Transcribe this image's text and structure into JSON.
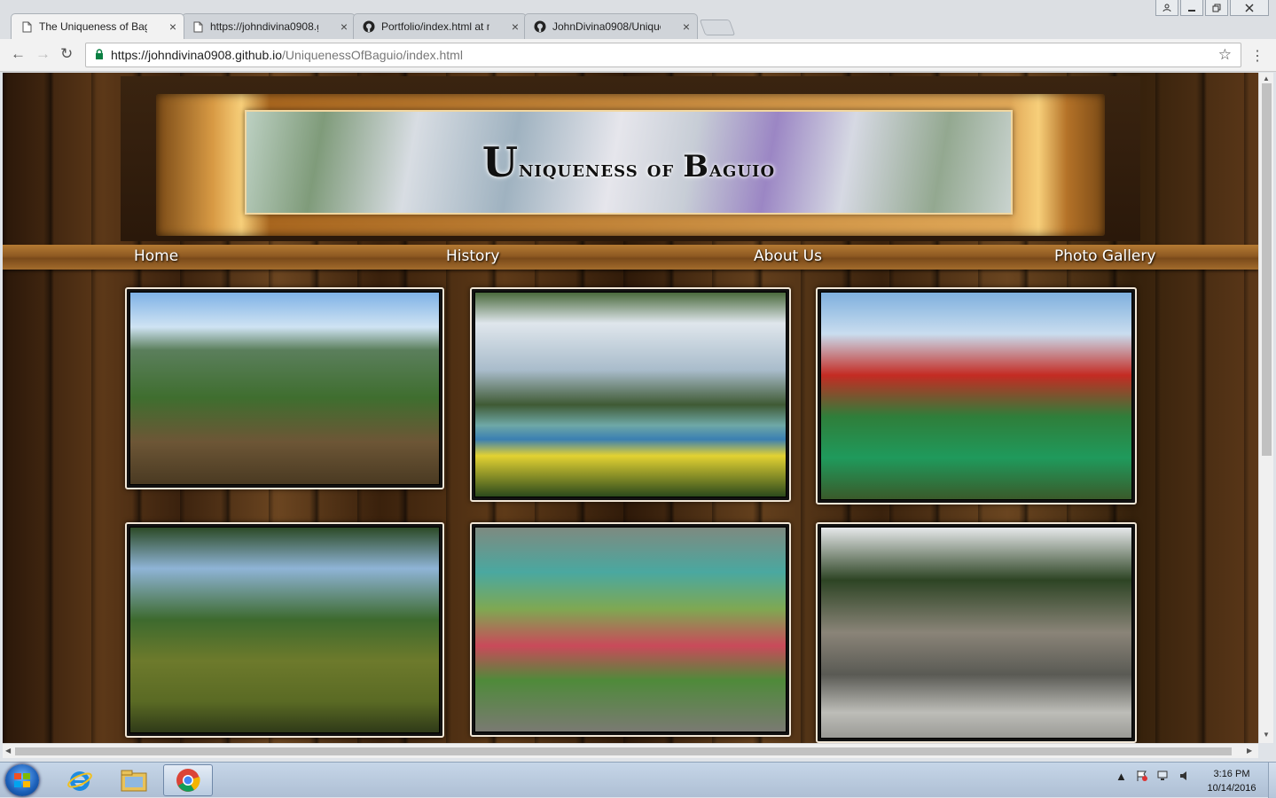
{
  "browser": {
    "tabs": [
      {
        "title": "The Uniqueness of Bagui",
        "icon": "page-icon",
        "active": true
      },
      {
        "title": "https://johndivina0908.g",
        "icon": "page-icon",
        "active": false
      },
      {
        "title": "Portfolio/index.html at m",
        "icon": "github-icon",
        "active": false
      },
      {
        "title": "JohnDivina0908/Uniquen",
        "icon": "github-icon",
        "active": false
      }
    ],
    "url_scheme_host": "https://johndivina0908.github.io",
    "url_path": "/UniquenessOfBaguio/index.html",
    "back_glyph": "←",
    "forward_glyph": "→",
    "reload_glyph": "↻",
    "star_glyph": "☆",
    "menu_glyph": "⋮",
    "close_glyph": "×"
  },
  "site": {
    "banner_title_first_cap": "U",
    "banner_title_rest": "niqueness of ",
    "banner_title_second_cap": "B",
    "banner_title_end": "aguio",
    "nav": [
      "Home",
      "History",
      "About Us",
      "Photo Gallery"
    ],
    "photos": [
      {
        "name": "mountain-view-photo"
      },
      {
        "name": "burnham-lake-boats-photo"
      },
      {
        "name": "bell-church-temple-photo"
      },
      {
        "name": "pine-park-pond-photo"
      },
      {
        "name": "botanical-garden-gazebo-photo"
      },
      {
        "name": "philippine-military-academy-gate-photo"
      }
    ]
  },
  "taskbar": {
    "time": "3:16 PM",
    "date": "10/14/2016"
  },
  "colors": {
    "nav_bar": "#8f5a22",
    "banner_frame": "#d89a44",
    "lock_green": "#0b8043"
  }
}
